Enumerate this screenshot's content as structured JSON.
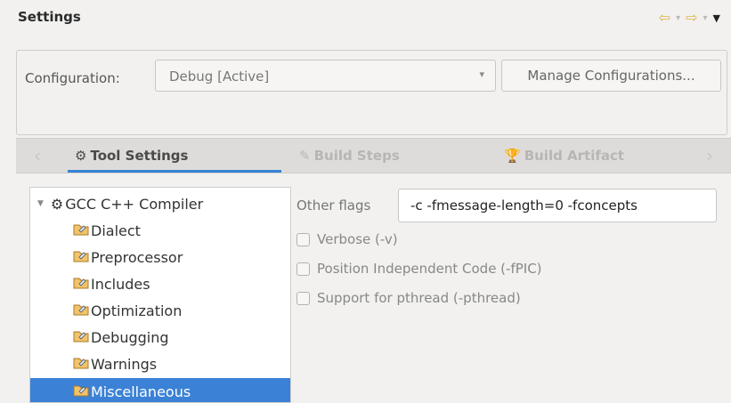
{
  "header": {
    "title": "Settings",
    "nav": {
      "back_icon": "⇦",
      "forward_icon": "⇨",
      "down_icon": "▾",
      "menu_icon": "▼"
    }
  },
  "configuration": {
    "label": "Configuration:",
    "selected": "Debug [Active]",
    "dropdown_icon": "▾",
    "manage_button": "Manage Configurations..."
  },
  "tabs": {
    "left_chevron": "‹",
    "right_chevron": "›",
    "items": [
      {
        "label": "Tool Settings",
        "icon": "⚙"
      },
      {
        "label": "Build Steps",
        "icon": "✎"
      },
      {
        "label": "Build Artifact",
        "icon": "🏆"
      }
    ]
  },
  "tree": {
    "root": {
      "label": "GCC C++ Compiler",
      "icon": "⚙",
      "expander": "▼"
    },
    "items": [
      {
        "label": "Dialect"
      },
      {
        "label": "Preprocessor"
      },
      {
        "label": "Includes"
      },
      {
        "label": "Optimization"
      },
      {
        "label": "Debugging"
      },
      {
        "label": "Warnings"
      },
      {
        "label": "Miscellaneous"
      }
    ]
  },
  "details": {
    "other_flags_label": "Other flags",
    "other_flags_value": "-c -fmessage-length=0 -fconcepts",
    "checkboxes": [
      {
        "label": "Verbose (-v)",
        "checked": false
      },
      {
        "label": "Position Independent Code (-fPIC)",
        "checked": false
      },
      {
        "label": "Support for pthread (-pthread)",
        "checked": false
      }
    ]
  },
  "colors": {
    "accent": "#3583d6",
    "selection": "#3b82d6",
    "nav_arrow": "#e0b14a"
  }
}
